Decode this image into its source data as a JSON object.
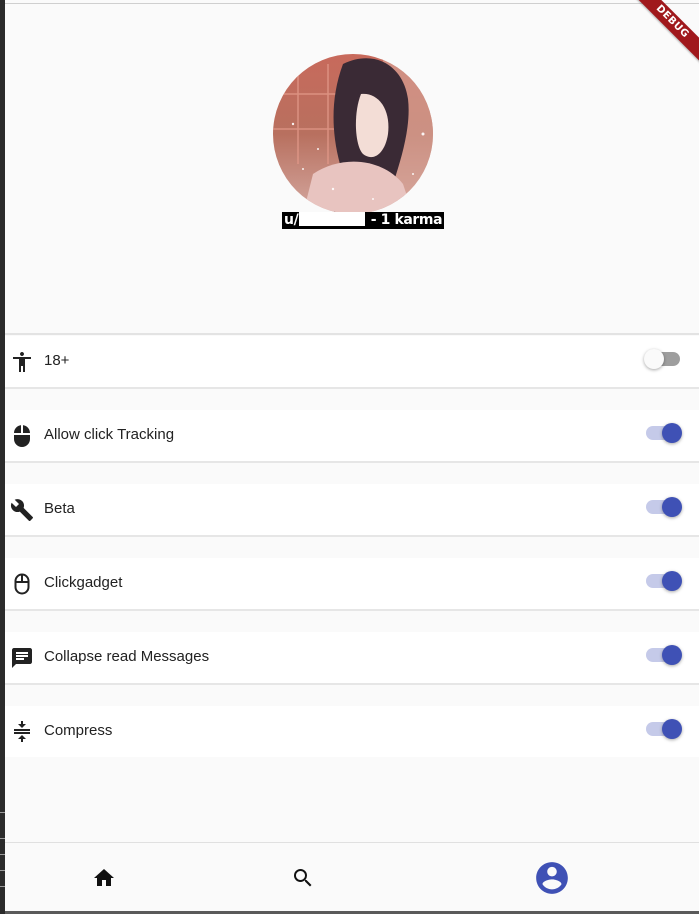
{
  "debug_banner": {
    "text": "DEBUG",
    "color": "#a0181c"
  },
  "profile": {
    "username_prefix": "u/",
    "karma_text": " - 1 karma"
  },
  "settings": [
    {
      "key": "nsfw",
      "icon": "accessibility-icon",
      "label": "18+",
      "enabled": false
    },
    {
      "key": "click_tracking",
      "icon": "mouse-icon",
      "label": "Allow click Tracking",
      "enabled": true
    },
    {
      "key": "beta",
      "icon": "wrench-icon",
      "label": "Beta",
      "enabled": true
    },
    {
      "key": "clickgadget",
      "icon": "mouse-outline-icon",
      "label": "Clickgadget",
      "enabled": true
    },
    {
      "key": "collapse_read",
      "icon": "message-icon",
      "label": "Collapse read Messages",
      "enabled": true
    },
    {
      "key": "compress",
      "icon": "compress-icon",
      "label": "Compress",
      "enabled": true
    }
  ],
  "bottom_nav": {
    "items": [
      {
        "key": "home",
        "icon": "home-icon",
        "active": false
      },
      {
        "key": "search",
        "icon": "search-icon",
        "active": false
      },
      {
        "key": "account",
        "icon": "account-circle-icon",
        "active": true
      }
    ]
  },
  "colors": {
    "accent": "#3f51b5",
    "accent_track": "#c5cae9",
    "background": "#fafafa"
  }
}
